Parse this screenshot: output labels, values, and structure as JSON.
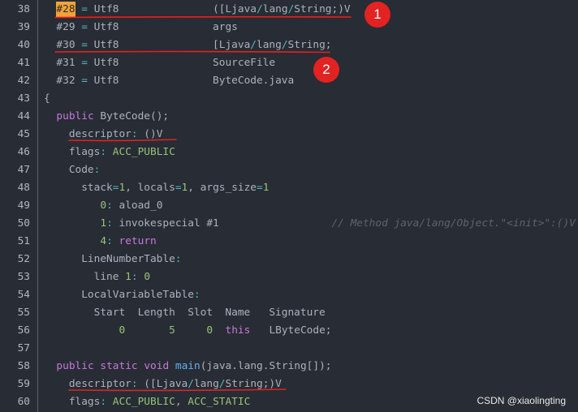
{
  "theme": {
    "background": "#282c34",
    "text": "#abb2bf",
    "line_number": "#b0b7c3",
    "gutter_divider": "#5c6370",
    "operator": "#56b6c2",
    "keyword": "#c678dd",
    "function": "#61afef",
    "literal": "#98c379",
    "comment": "#5c6370",
    "search_highlight": "#f0a33b",
    "annotation_red": "#e32222"
  },
  "editor": {
    "lines": [
      {
        "n": "38",
        "t": [
          "  ",
          "#28",
          " ",
          "=",
          " Utf8               ([Ljava",
          "/",
          "lang",
          "/",
          "String;)V"
        ]
      },
      {
        "n": "39",
        "t": [
          "  #29 ",
          "=",
          " Utf8               args"
        ]
      },
      {
        "n": "40",
        "t": [
          "  #30 ",
          "=",
          " Utf8               [Ljava",
          "/",
          "lang",
          "/",
          "String;"
        ]
      },
      {
        "n": "41",
        "t": [
          "  #31 ",
          "=",
          " Utf8               SourceFile"
        ]
      },
      {
        "n": "42",
        "t": [
          "  #32 ",
          "=",
          " Utf8               ByteCode.java"
        ]
      },
      {
        "n": "43",
        "t": [
          "{"
        ]
      },
      {
        "n": "44",
        "t": [
          "  ",
          "public",
          " ByteCode();"
        ]
      },
      {
        "n": "45",
        "t": [
          "    descriptor",
          ":",
          " ()V"
        ]
      },
      {
        "n": "46",
        "t": [
          "    flags",
          ":",
          " ",
          "ACC_PUBLIC"
        ]
      },
      {
        "n": "47",
        "t": [
          "    Code",
          ":"
        ]
      },
      {
        "n": "48",
        "t": [
          "      stack",
          "=",
          "1",
          ", locals",
          "=",
          "1",
          ", args_size",
          "=",
          "1"
        ]
      },
      {
        "n": "49",
        "t": [
          "         ",
          "0",
          ":",
          " aload_0"
        ]
      },
      {
        "n": "50",
        "t": [
          "         ",
          "1",
          ":",
          " invokespecial #1",
          "                  ",
          "// Method java/lang/Object.\"<init>\":()V"
        ]
      },
      {
        "n": "51",
        "t": [
          "         ",
          "4",
          ":",
          " ",
          "return"
        ]
      },
      {
        "n": "52",
        "t": [
          "      LineNumberTable",
          ":"
        ]
      },
      {
        "n": "53",
        "t": [
          "        line ",
          "1",
          ":",
          " ",
          "0"
        ]
      },
      {
        "n": "54",
        "t": [
          "      LocalVariableTable",
          ":"
        ]
      },
      {
        "n": "55",
        "t": [
          "        Start  Length  Slot  Name   Signature"
        ]
      },
      {
        "n": "56",
        "t": [
          "            ",
          "0",
          "       ",
          "5",
          "     ",
          "0",
          "  ",
          "this",
          "   LByteCode;"
        ]
      },
      {
        "n": "57",
        "t": [
          ""
        ]
      },
      {
        "n": "58",
        "t": [
          "  ",
          "public",
          " ",
          "static",
          " ",
          "void",
          " ",
          "main",
          "(java.lang.String[]);"
        ]
      },
      {
        "n": "59",
        "t": [
          "    descriptor",
          ":",
          " ([Ljava",
          "/",
          "lang",
          "/",
          "String;)V"
        ]
      },
      {
        "n": "60",
        "t": [
          "    flags",
          ":",
          " ",
          "ACC_PUBLIC",
          ", ",
          "ACC_STATIC"
        ]
      }
    ]
  },
  "annotations": {
    "badges": [
      "1",
      "2"
    ]
  },
  "watermark": {
    "text": "CSDN @xiaolingting"
  }
}
